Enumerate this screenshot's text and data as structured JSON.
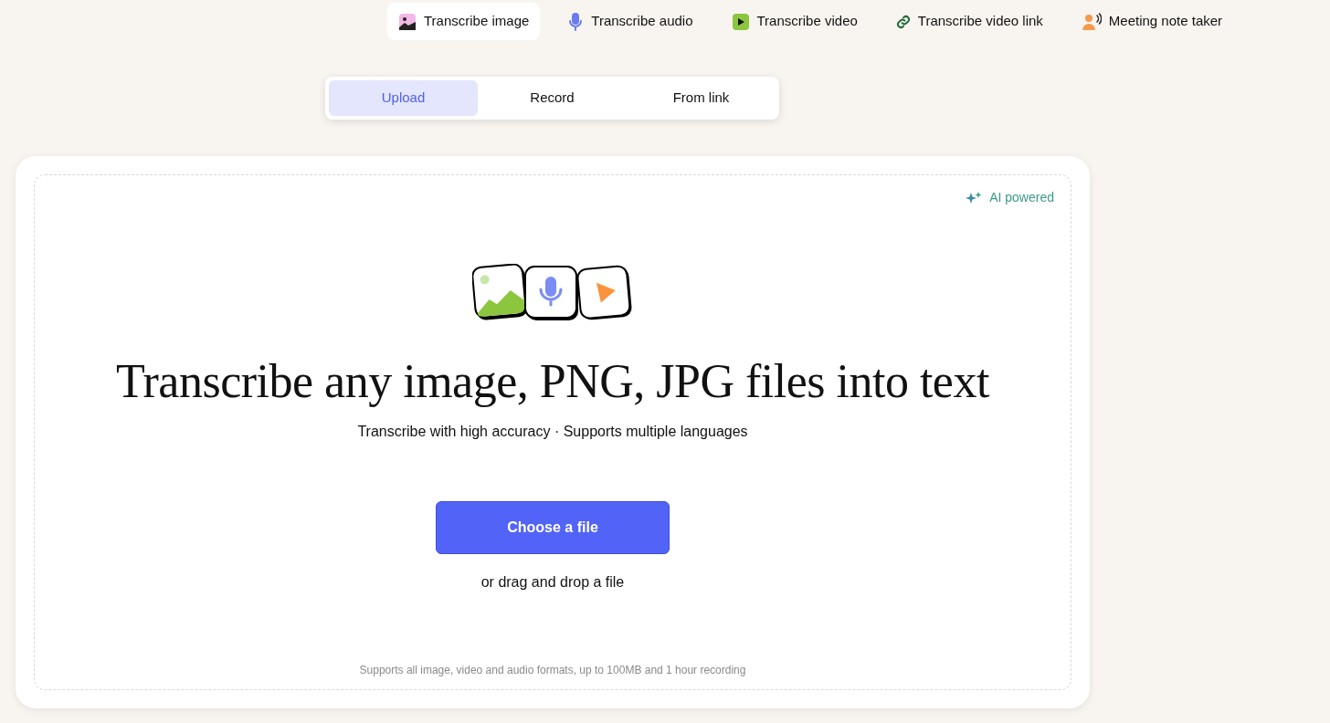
{
  "nav": [
    {
      "kind": "image",
      "label": "Transcribe image",
      "selected": true
    },
    {
      "kind": "audio",
      "label": "Transcribe audio",
      "selected": false
    },
    {
      "kind": "video",
      "label": "Transcribe video",
      "selected": false
    },
    {
      "kind": "link",
      "label": "Transcribe video link",
      "selected": false
    },
    {
      "kind": "meeting",
      "label": "Meeting note taker",
      "selected": false
    }
  ],
  "tabs": [
    {
      "label": "Upload",
      "selected": true
    },
    {
      "label": "Record",
      "selected": false
    },
    {
      "label": "From link",
      "selected": false
    }
  ],
  "badge": "AI powered",
  "heading": "Transcribe any image, PNG, JPG files into text",
  "subheading": "Transcribe with high accuracy · Supports multiple languages",
  "button": "Choose a file",
  "drop_hint": "or drag and drop a file",
  "footnote": "Supports all image, video and audio formats, up to 100MB and 1 hour recording"
}
